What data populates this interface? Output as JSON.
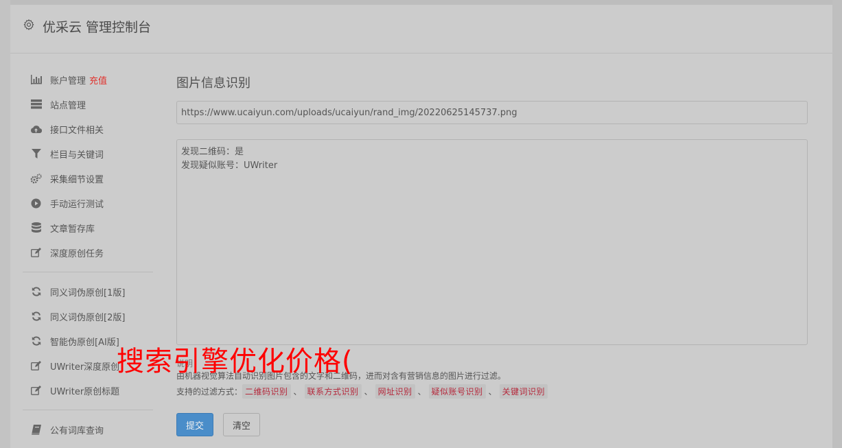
{
  "header": {
    "title": "优采云 管理控制台",
    "icon": "gear-icon"
  },
  "sidebar": {
    "group1": [
      {
        "label": "账户管理",
        "extra": "充值",
        "icon": "bar-chart-icon"
      },
      {
        "label": "站点管理",
        "icon": "server-icon"
      },
      {
        "label": "接口文件相关",
        "icon": "cloud-upload-icon"
      },
      {
        "label": "栏目与关键词",
        "icon": "filter-icon"
      },
      {
        "label": "采集细节设置",
        "icon": "gears-icon"
      },
      {
        "label": "手动运行测试",
        "icon": "play-circle-icon"
      },
      {
        "label": "文章暂存库",
        "icon": "database-icon"
      },
      {
        "label": "深度原创任务",
        "icon": "edit-icon"
      }
    ],
    "group2": [
      {
        "label": "同义词伪原创[1版]",
        "icon": "refresh-icon"
      },
      {
        "label": "同义词伪原创[2版]",
        "icon": "refresh-icon"
      },
      {
        "label": "智能伪原创[AI版]",
        "icon": "refresh-icon"
      },
      {
        "label": "UWriter深度原创",
        "icon": "edit-icon"
      },
      {
        "label": "UWriter原创标题",
        "icon": "edit-icon"
      }
    ],
    "group3": [
      {
        "label": "公有词库查询",
        "icon": "book-icon"
      }
    ]
  },
  "main": {
    "title": "图片信息识别",
    "url_value": "https://www.ucaiyun.com/uploads/ucaiyun/rand_img/20220625145737.png",
    "result_text": "发现二维码：是\n发现疑似账号：UWriter",
    "help_label": "说明",
    "help_text": "由机器视觉算法自动识别图片包含的文字和二维码，进而对含有营销信息的图片进行过滤。",
    "filters_label": "支持的过滤方式：",
    "filters": [
      "二维码识别",
      "联系方式识别",
      "网址识别",
      "疑似账号识别",
      "关键词识别"
    ],
    "filter_separator": "、",
    "submit_label": "提交",
    "clear_label": "清空"
  },
  "overlay_text": "搜索引擎优化价格(",
  "colors": {
    "accent": "#4a8dc9",
    "highlight": "#e0322d",
    "tag_text": "#b5293c",
    "overlay": "#ff0000"
  }
}
